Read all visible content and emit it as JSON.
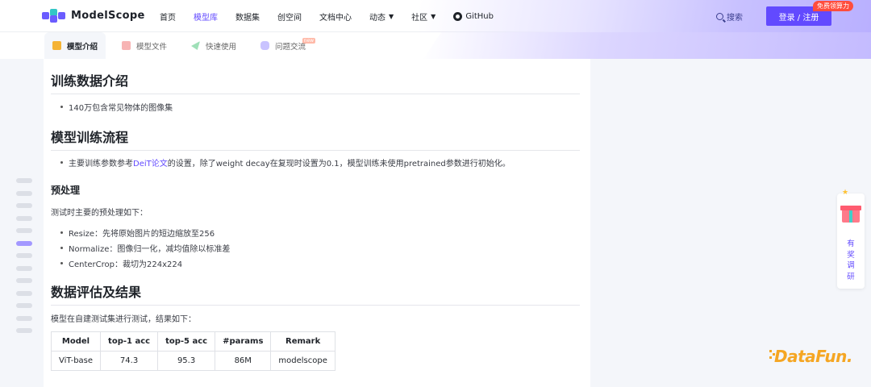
{
  "colors": {
    "accent": "#624aff",
    "badge": "#ff4d3d",
    "brand_logo": "#6b5cff",
    "datafun": "#f5a623"
  },
  "header": {
    "brand": "ModelScope",
    "nav": [
      {
        "label": "首页"
      },
      {
        "label": "模型库",
        "active": true
      },
      {
        "label": "数据集"
      },
      {
        "label": "创空间"
      },
      {
        "label": "文档中心"
      },
      {
        "label": "动态",
        "caret": true
      },
      {
        "label": "社区",
        "caret": true
      },
      {
        "label": "GitHub",
        "icon": "github-icon"
      }
    ],
    "search_label": "搜索",
    "login_label": "登录 / 注册",
    "badge": "免费领算力"
  },
  "tabs": [
    {
      "label": "模型介绍",
      "icon": "cube-icon",
      "active": true
    },
    {
      "label": "模型文件",
      "icon": "file-icon"
    },
    {
      "label": "快速使用",
      "icon": "paper-plane-icon"
    },
    {
      "label": "问题交流",
      "icon": "chat-icon",
      "tag": "new"
    }
  ],
  "content": {
    "s1_title": "训练数据介绍",
    "s1_items": [
      "140万包含常见物体的图像集"
    ],
    "s2_title": "模型训练流程",
    "s2_text_pre": "主要训练参数参考",
    "s2_link": "DeiT论文",
    "s2_text_post": "的设置，除了weight decay在复现时设置为0.1，模型训练未使用pretrained参数进行初始化。",
    "s3_title": "预处理",
    "s3_intro": "测试时主要的预处理如下：",
    "s3_items": [
      "Resize：先将原始图片的短边缩放至256",
      "Normalize：图像归一化，减均值除以标准差",
      "CenterCrop：裁切为224x224"
    ],
    "s4_title": "数据评估及结果",
    "s4_intro": "模型在自建测试集进行测试，结果如下：",
    "table": {
      "headers": [
        "Model",
        "top-1 acc",
        "top-5 acc",
        "#params",
        "Remark"
      ],
      "rows": [
        [
          "ViT-base",
          "74.3",
          "95.3",
          "86M",
          "modelscope"
        ]
      ]
    }
  },
  "toc": {
    "count": 13,
    "active_index": 5
  },
  "survey": {
    "label": "有奖调研",
    "icon": "gift-icon"
  },
  "watermark": "DataFun."
}
